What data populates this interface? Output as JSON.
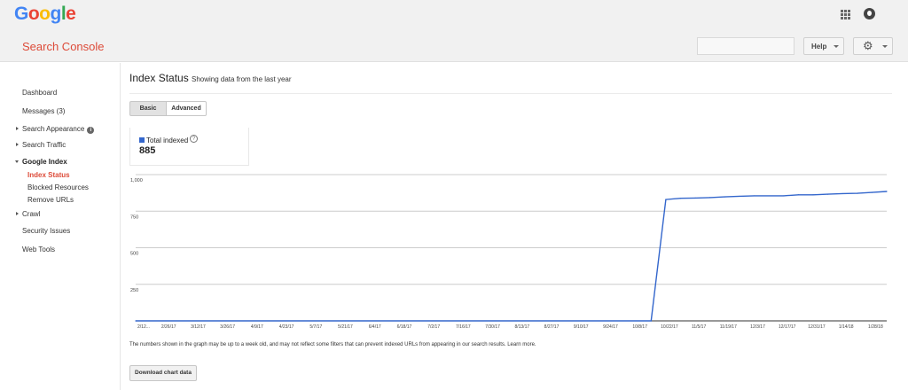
{
  "brand": {
    "logo_letters": [
      {
        "ch": "G",
        "color": "#4285f4"
      },
      {
        "ch": "o",
        "color": "#ea4335"
      },
      {
        "ch": "o",
        "color": "#fbbc05"
      },
      {
        "ch": "g",
        "color": "#4285f4"
      },
      {
        "ch": "l",
        "color": "#34a853"
      },
      {
        "ch": "e",
        "color": "#ea4335"
      }
    ],
    "product": "Search Console",
    "accent": "#dd4b39"
  },
  "topbar": {
    "apps_icon": "apps-grid-icon",
    "account_icon": "account-icon"
  },
  "header": {
    "search_placeholder": "",
    "help_label": "Help",
    "settings_icon": "gear-icon"
  },
  "sidebar": {
    "items": [
      {
        "label": "Dashboard"
      },
      {
        "label": "Messages (3)"
      },
      {
        "label": "Search Appearance"
      },
      {
        "label": "Search Traffic"
      },
      {
        "label": "Google Index"
      },
      {
        "label": "Index Status"
      },
      {
        "label": "Blocked Resources"
      },
      {
        "label": "Remove URLs"
      },
      {
        "label": "Crawl"
      },
      {
        "label": "Security Issues"
      },
      {
        "label": "Web Tools"
      }
    ]
  },
  "main": {
    "title": "Index Status",
    "subtitle": "Showing data from the last year",
    "tabs": [
      {
        "label": "Basic",
        "selected": true
      },
      {
        "label": "Advanced",
        "selected": false
      }
    ],
    "metric": {
      "label": "Total indexed",
      "value": "885",
      "color": "#3366cc"
    },
    "footnote": "The numbers shown in the graph may be up to a week old, and may not reflect some filters that can prevent indexed URLs from appearing in our search results. Learn more.",
    "download_label": "Download chart data"
  },
  "chart_data": {
    "type": "line",
    "ylim": [
      0,
      1000
    ],
    "y_ticks": [
      {
        "value": 1000,
        "label": "1,000"
      },
      {
        "value": 750,
        "label": "750"
      },
      {
        "value": 500,
        "label": "500"
      },
      {
        "value": 250,
        "label": "250"
      }
    ],
    "x_ticks": [
      "2/12...",
      "2/26/17",
      "3/12/17",
      "3/26/17",
      "4/9/17",
      "4/23/17",
      "5/7/17",
      "5/21/17",
      "6/4/17",
      "6/18/17",
      "7/2/17",
      "7/16/17",
      "7/30/17",
      "8/13/17",
      "8/27/17",
      "9/10/17",
      "9/24/17",
      "10/8/17",
      "10/22/17",
      "11/5/17",
      "11/19/17",
      "12/3/17",
      "12/17/17",
      "12/31/17",
      "1/14/18",
      "1/28/18"
    ],
    "series": [
      {
        "name": "Total indexed",
        "color": "#3366cc",
        "points": [
          [
            "2/12/17",
            0
          ],
          [
            "10/15/17",
            0
          ],
          [
            "10/22/17",
            830
          ],
          [
            "10/29/17",
            838
          ],
          [
            "11/5/17",
            840
          ],
          [
            "11/12/17",
            843
          ],
          [
            "11/19/17",
            848
          ],
          [
            "11/26/17",
            852
          ],
          [
            "12/3/17",
            855
          ],
          [
            "12/17/17",
            855
          ],
          [
            "12/24/17",
            862
          ],
          [
            "12/31/17",
            862
          ],
          [
            "1/7/18",
            866
          ],
          [
            "1/14/18",
            870
          ],
          [
            "1/21/18",
            872
          ],
          [
            "1/28/18",
            878
          ],
          [
            "2/4/18",
            885
          ]
        ]
      }
    ]
  }
}
